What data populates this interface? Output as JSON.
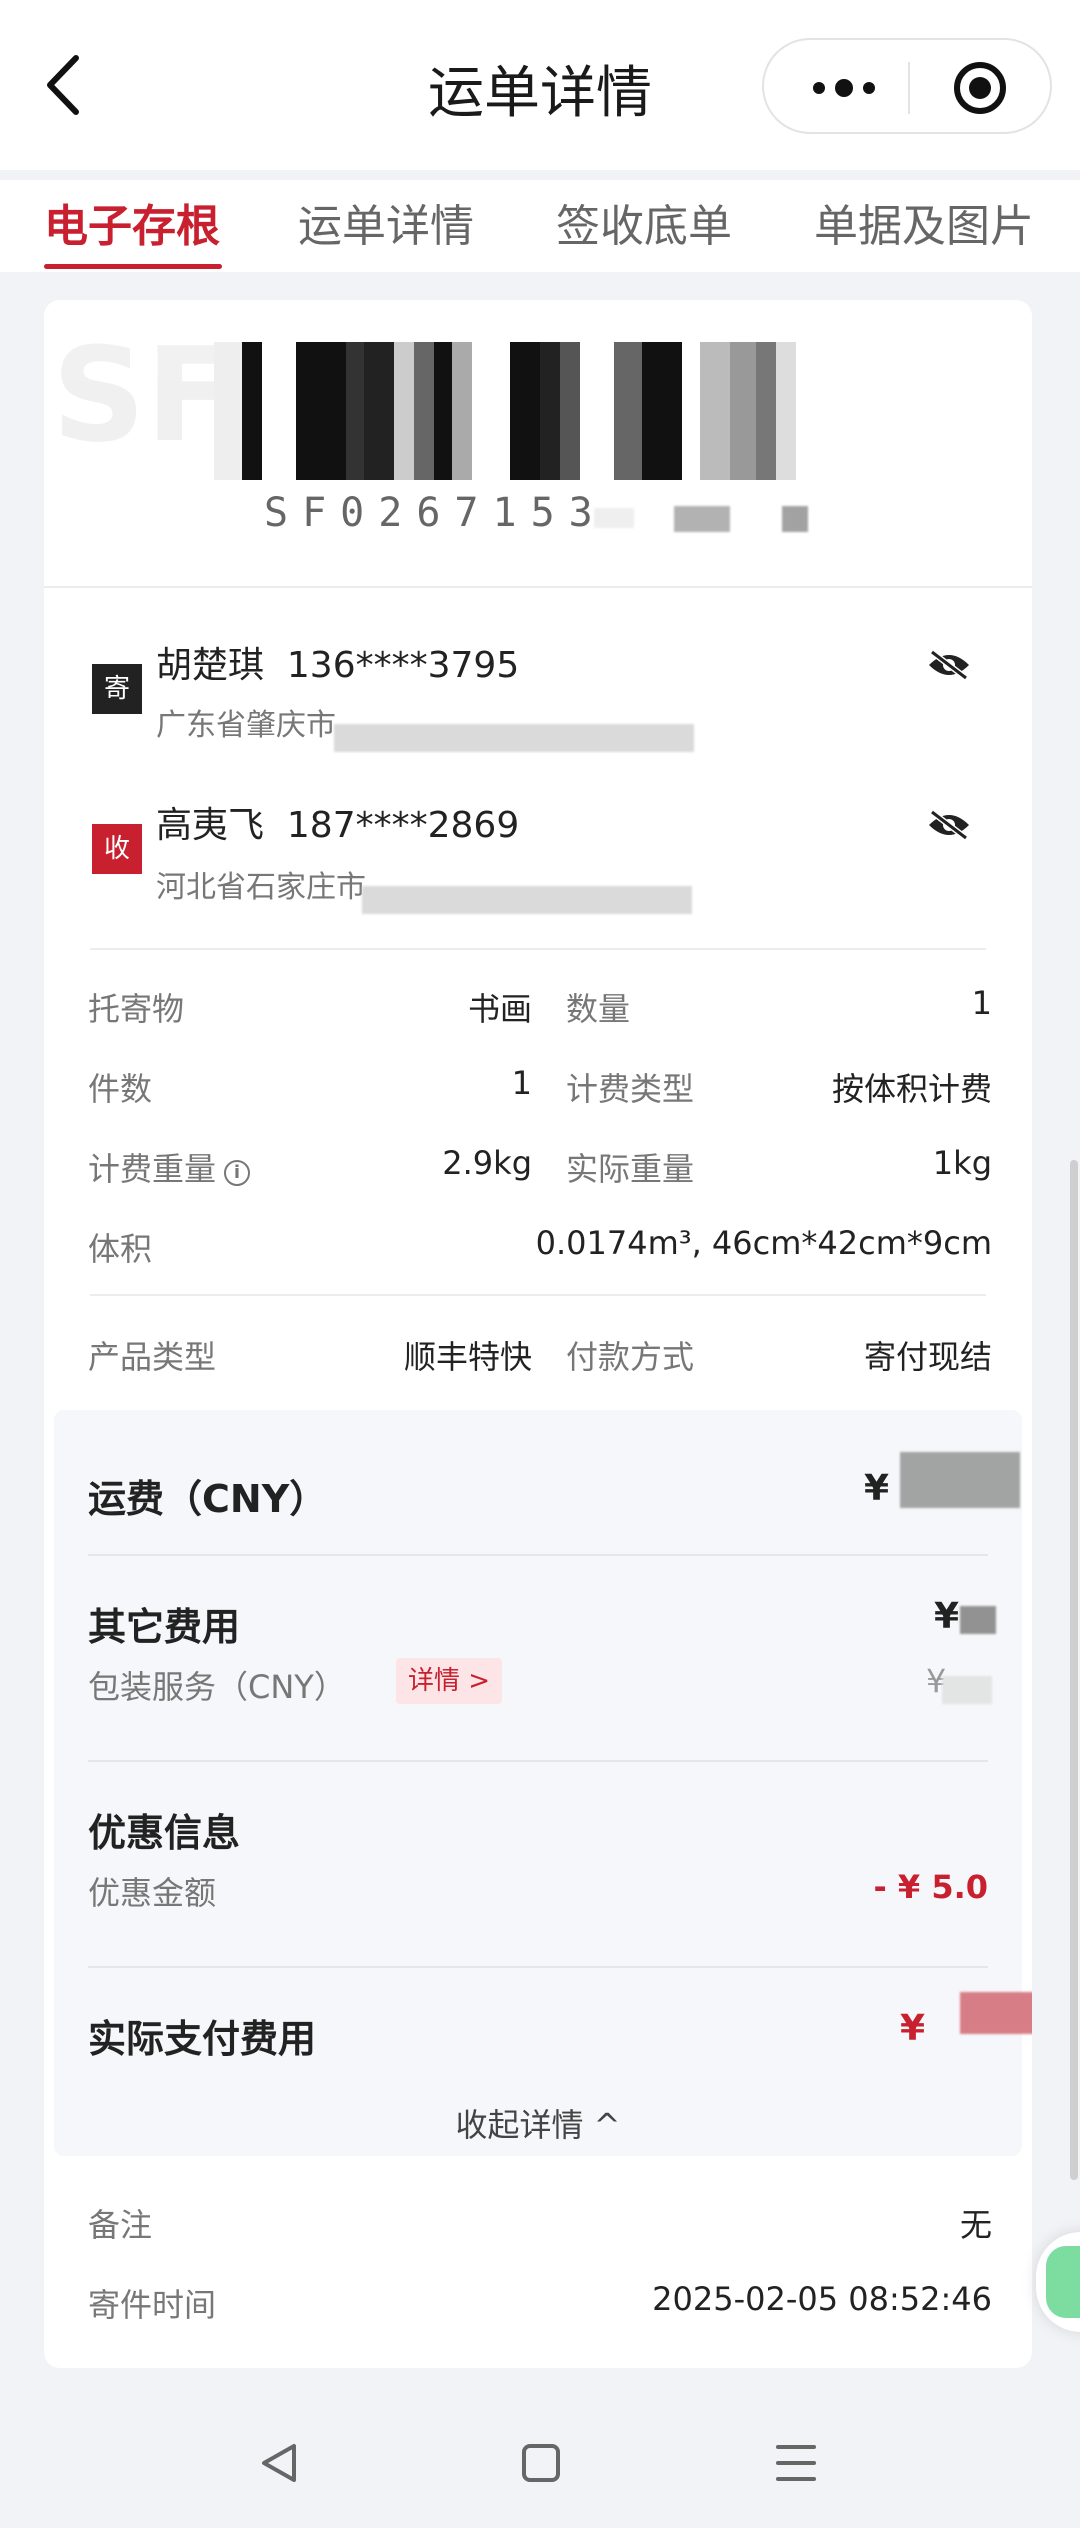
{
  "header": {
    "title": "运单详情",
    "back_icon": "chevron-left-icon",
    "more_icon": "more-dots-icon",
    "target_icon": "target-icon"
  },
  "tabs": [
    {
      "label": "电子存根",
      "active": true
    },
    {
      "label": "运单详情",
      "active": false
    },
    {
      "label": "签收底单",
      "active": false
    },
    {
      "label": "单据及图片",
      "active": false
    }
  ],
  "waybill": {
    "number_visible": "SF0267153"
  },
  "sender": {
    "badge": "寄",
    "name": "胡楚琪",
    "phone": "136****3795",
    "address": "广东省肇庆市"
  },
  "receiver": {
    "badge": "收",
    "name": "高夷飞",
    "phone": "187****2869",
    "address": "河北省石家庄市"
  },
  "details": {
    "goods_label": "托寄物",
    "goods_value": "书画",
    "quantity_label": "数量",
    "quantity_value": "1",
    "pieces_label": "件数",
    "pieces_value": "1",
    "billing_type_label": "计费类型",
    "billing_type_value": "按体积计费",
    "billing_weight_label": "计费重量",
    "billing_weight_value": "2.9kg",
    "actual_weight_label": "实际重量",
    "actual_weight_value": "1kg",
    "volume_label": "体积",
    "volume_value": "0.0174m³, 46cm*42cm*9cm",
    "product_type_label": "产品类型",
    "product_type_value": "顺丰特快",
    "payment_label": "付款方式",
    "payment_value": "寄付现结"
  },
  "fees": {
    "freight_label": "运费（CNY）",
    "currency_symbol": "¥",
    "other_label": "其它费用",
    "packaging_label": "包装服务（CNY）",
    "detail_tag": "详情 >",
    "discount_title": "优惠信息",
    "discount_label": "优惠金额",
    "discount_value": "- ¥ 5.0",
    "actual_label": "实际支付费用",
    "collapse_label": "收起详情 ^"
  },
  "remarks": {
    "remark_label": "备注",
    "remark_value": "无",
    "time_label": "寄件时间",
    "time_value": "2025-02-05 08:52:46"
  },
  "colors": {
    "accent": "#c8202f",
    "background": "#f2f3f6"
  }
}
